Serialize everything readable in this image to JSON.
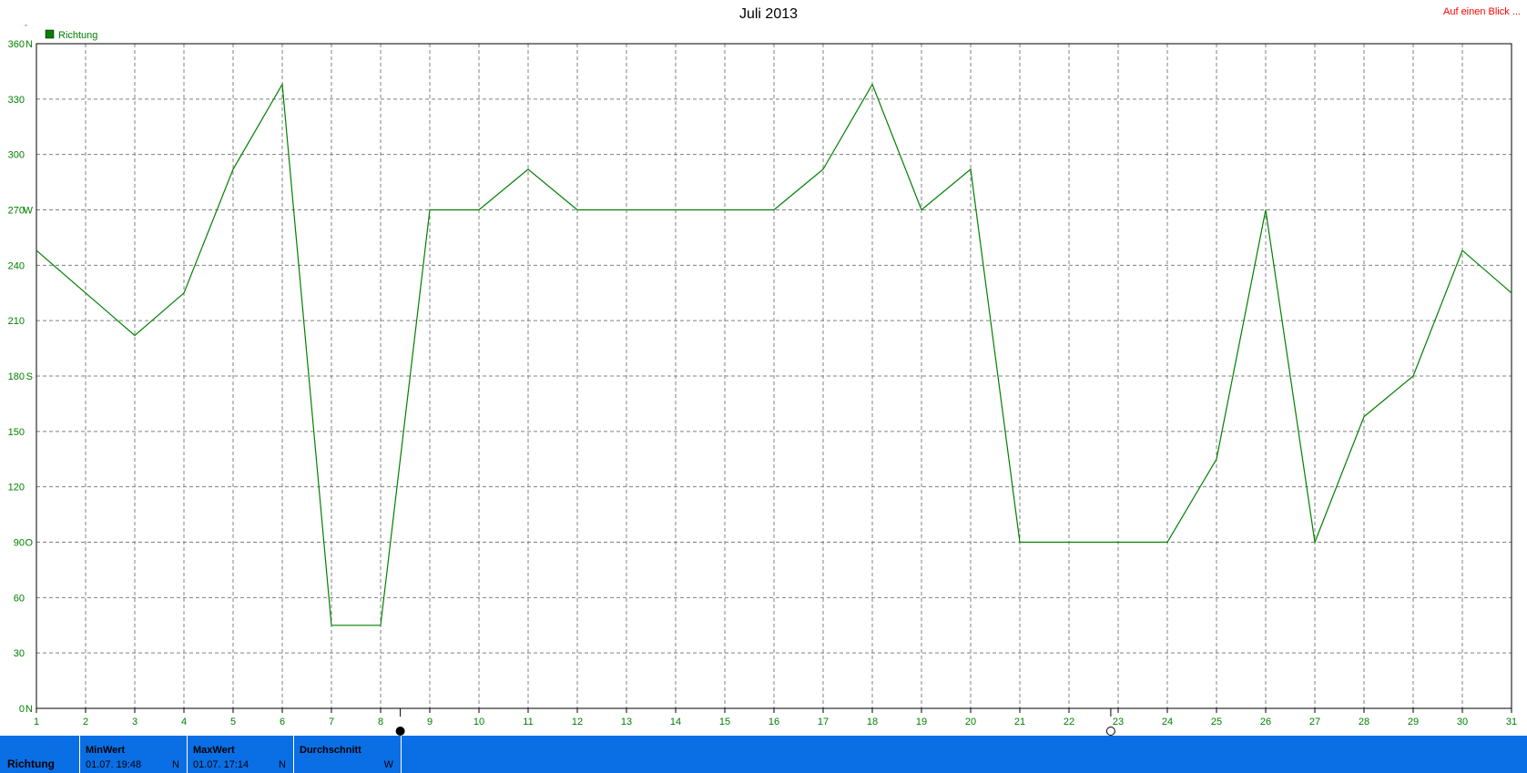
{
  "header": {
    "title": "Juli 2013",
    "link_label": "Auf einen Blick ..."
  },
  "colors": {
    "series": "#008000",
    "grid": "#808080",
    "axis": "#000000",
    "link": "#ff0000",
    "stats_bar": "#0a6ee4"
  },
  "chart_data": {
    "type": "line",
    "title": "Juli 2013",
    "xlabel": "",
    "ylabel": "",
    "xlim": [
      1,
      31
    ],
    "ylim": [
      0,
      360
    ],
    "grid": true,
    "legend": "top-left",
    "x_ticks": [
      "1",
      "2",
      "3",
      "4",
      "5",
      "6",
      "7",
      "8",
      "9",
      "10",
      "11",
      "12",
      "13",
      "14",
      "15",
      "16",
      "17",
      "18",
      "19",
      "20",
      "21",
      "22",
      "23",
      "24",
      "25",
      "26",
      "27",
      "28",
      "29",
      "30",
      "31"
    ],
    "y_ticks": [
      {
        "value": 0,
        "label": "0",
        "dir": "N"
      },
      {
        "value": 30,
        "label": "30",
        "dir": ""
      },
      {
        "value": 60,
        "label": "60",
        "dir": ""
      },
      {
        "value": 90,
        "label": "90",
        "dir": "O"
      },
      {
        "value": 120,
        "label": "120",
        "dir": ""
      },
      {
        "value": 150,
        "label": "150",
        "dir": ""
      },
      {
        "value": 180,
        "label": "180",
        "dir": "S"
      },
      {
        "value": 210,
        "label": "210",
        "dir": ""
      },
      {
        "value": 240,
        "label": "240",
        "dir": ""
      },
      {
        "value": 270,
        "label": "270",
        "dir": "W"
      },
      {
        "value": 300,
        "label": "300",
        "dir": ""
      },
      {
        "value": 330,
        "label": "330",
        "dir": ""
      },
      {
        "value": 360,
        "label": "360",
        "dir": "N"
      }
    ],
    "series": [
      {
        "name": "Richtung",
        "color": "#008000",
        "x": [
          1,
          2,
          3,
          4,
          5,
          6,
          7,
          8,
          9,
          10,
          11,
          12,
          13,
          14,
          15,
          16,
          17,
          18,
          19,
          20,
          21,
          22,
          23,
          24,
          25,
          26,
          27,
          28,
          29,
          30,
          31
        ],
        "values": [
          248,
          225,
          202,
          225,
          292,
          338,
          45,
          45,
          270,
          270,
          292,
          270,
          270,
          270,
          270,
          270,
          292,
          338,
          270,
          292,
          90,
          90,
          90,
          90,
          135,
          270,
          90,
          158,
          180,
          248,
          225
        ]
      }
    ],
    "markers": [
      {
        "x": 8.4,
        "icon": "new-moon-icon"
      },
      {
        "x": 22.85,
        "icon": "full-moon-icon"
      }
    ]
  },
  "stats": {
    "row_label": "Richtung",
    "cells": [
      {
        "header": "MinWert",
        "time": "01.07.  19:48",
        "value": "N"
      },
      {
        "header": "MaxWert",
        "time": "01.07.  17:14",
        "value": "N"
      },
      {
        "header": "Durchschnitt",
        "time": "",
        "value": "W"
      }
    ]
  }
}
